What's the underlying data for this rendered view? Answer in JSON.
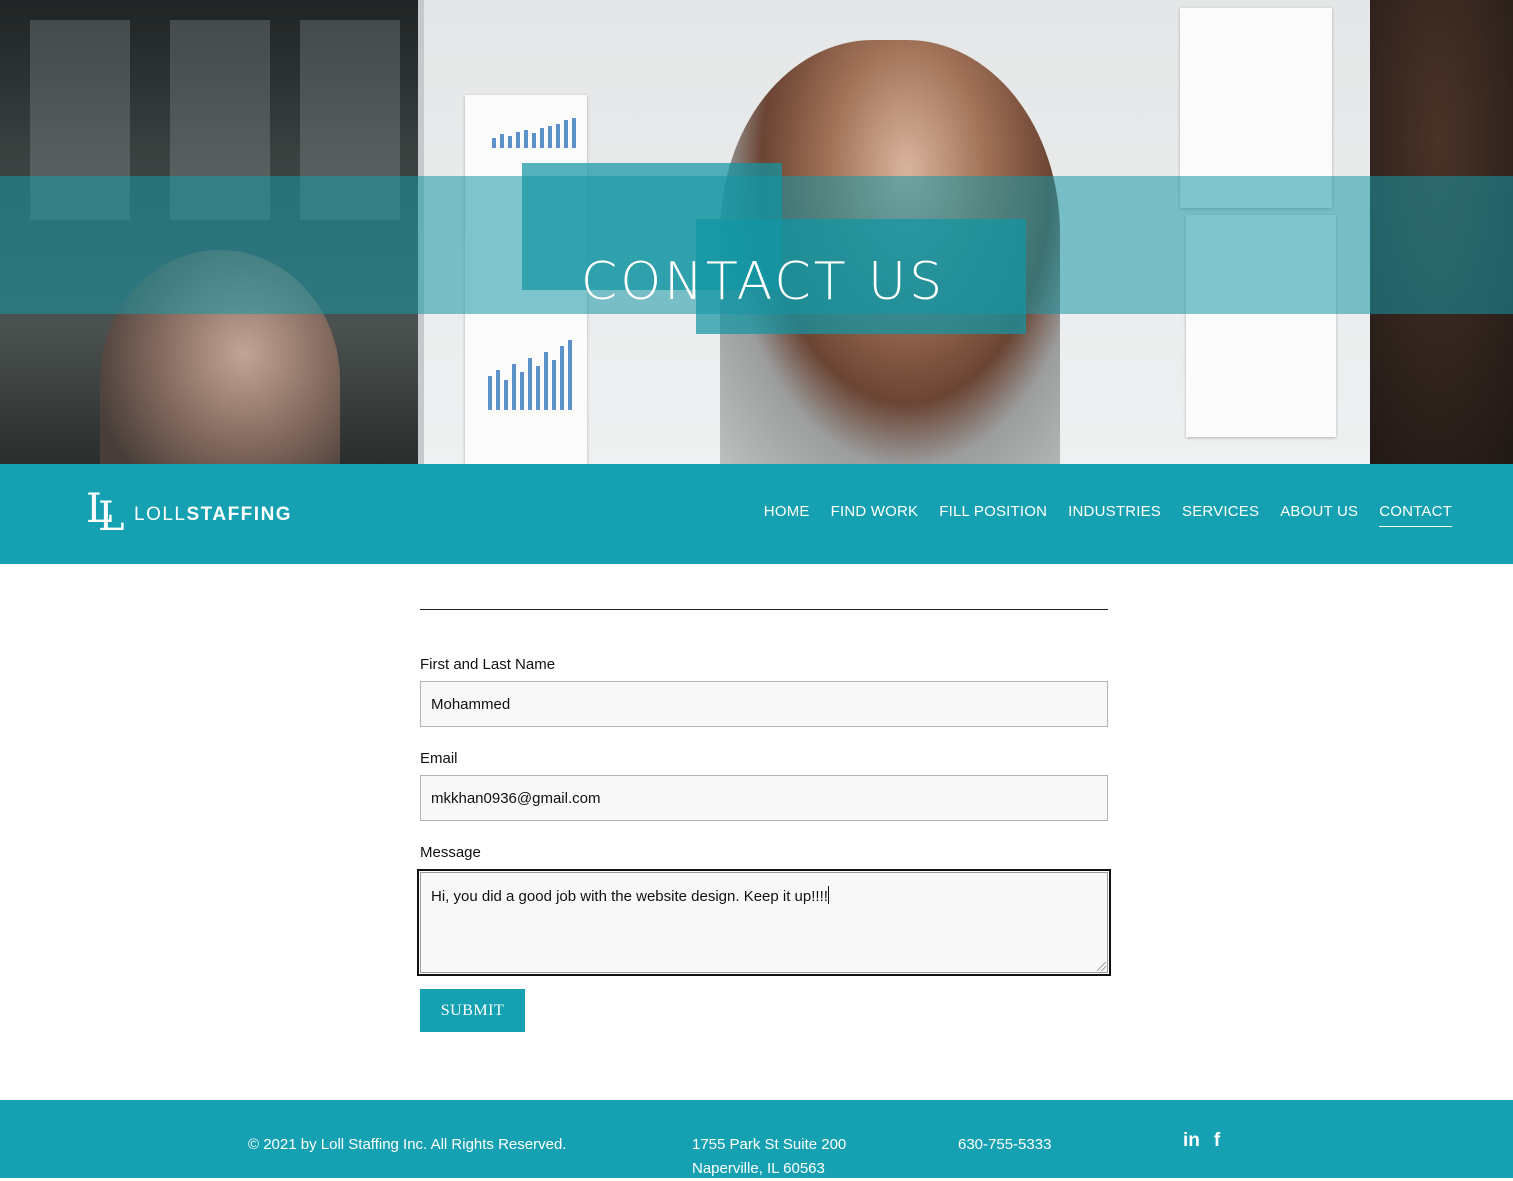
{
  "hero": {
    "title": "CONTACT US"
  },
  "nav": {
    "logo": {
      "mark": "LL",
      "word_light": "LOLL",
      "word_bold": "STAFFING"
    },
    "items": [
      {
        "label": "HOME",
        "active": false
      },
      {
        "label": "FIND WORK",
        "active": false
      },
      {
        "label": "FILL POSITION",
        "active": false
      },
      {
        "label": "INDUSTRIES",
        "active": false
      },
      {
        "label": "SERVICES",
        "active": false
      },
      {
        "label": "ABOUT US",
        "active": false
      },
      {
        "label": "CONTACT",
        "active": true
      }
    ]
  },
  "form": {
    "name": {
      "label": "First and Last Name",
      "value": "Mohammed"
    },
    "email": {
      "label": "Email",
      "value": "mkkhan0936@gmail.com"
    },
    "message": {
      "label": "Message",
      "value": "Hi, you did a good job with the website design. Keep it up!!!!"
    },
    "submit_label": "SUBMIT"
  },
  "footer": {
    "copyright": "© 2021 by Loll Staffing Inc. All Rights Reserved.",
    "address_line1": "1755 Park St Suite 200",
    "address_line2": "Naperville, IL 60563",
    "phone": "630-755-5333",
    "social": [
      {
        "icon": "linkedin-icon",
        "glyph": "in"
      },
      {
        "icon": "facebook-icon",
        "glyph": "f"
      }
    ]
  },
  "colors": {
    "accent": "#15a1b1",
    "text": "#111111",
    "field_bg": "#f8f8f8"
  }
}
